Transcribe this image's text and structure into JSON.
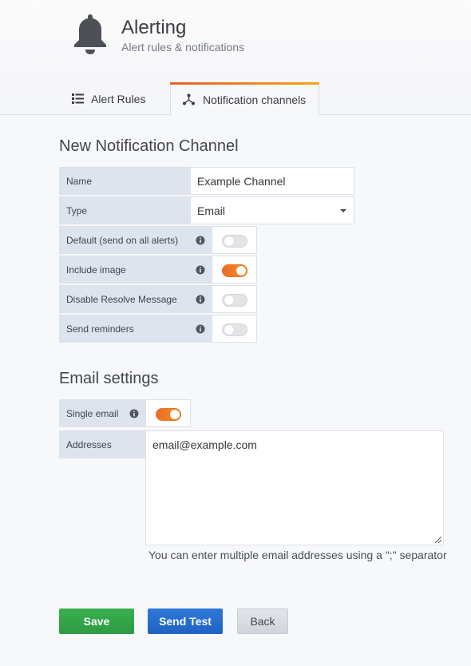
{
  "header": {
    "title": "Alerting",
    "subtitle": "Alert rules & notifications",
    "icon": "bell-icon"
  },
  "tabs": [
    {
      "label": "Alert Rules",
      "icon": "list-icon",
      "active": false
    },
    {
      "label": "Notification channels",
      "icon": "channels-icon",
      "active": true
    }
  ],
  "form": {
    "title": "New Notification Channel",
    "name_label": "Name",
    "name_value": "Example Channel",
    "type_label": "Type",
    "type_value": "Email",
    "toggles": [
      {
        "label": "Default (send on all alerts)",
        "on": false
      },
      {
        "label": "Include image",
        "on": true
      },
      {
        "label": "Disable Resolve Message",
        "on": false
      },
      {
        "label": "Send reminders",
        "on": false
      }
    ]
  },
  "email": {
    "title": "Email settings",
    "single_label": "Single email",
    "single_on": true,
    "addresses_label": "Addresses",
    "addresses_value": "email@example.com",
    "help": "You can enter multiple email addresses using a \";\" separator"
  },
  "buttons": {
    "save": "Save",
    "test": "Send Test",
    "back": "Back"
  },
  "colors": {
    "accent": "#f7941d",
    "save": "#37a84b",
    "test": "#2a70d2"
  }
}
